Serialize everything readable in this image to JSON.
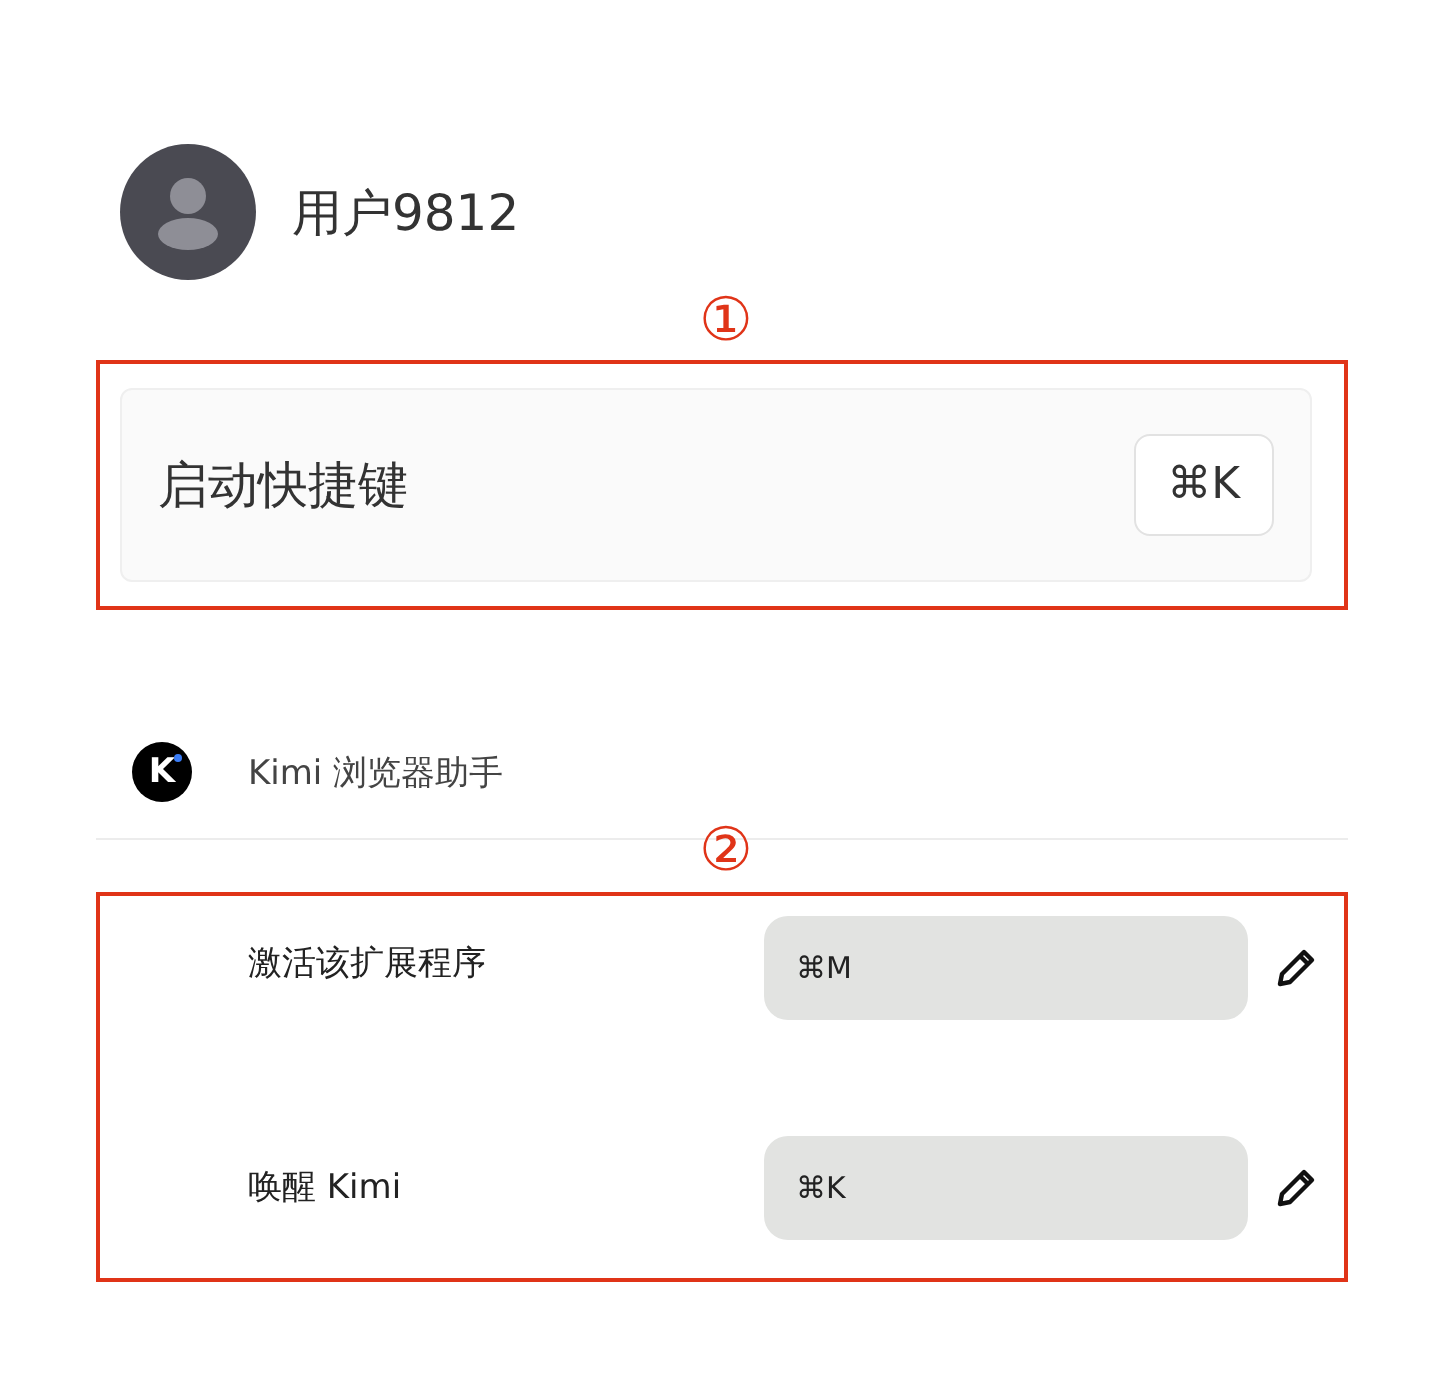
{
  "user": {
    "name": "用户9812"
  },
  "annotations": [
    "①",
    "②"
  ],
  "launch_shortcut": {
    "label": "启动快捷键",
    "key": "⌘K"
  },
  "extension": {
    "logo_text": "K",
    "name": "Kimi 浏览器助手"
  },
  "shortcuts": [
    {
      "label": "激活该扩展程序",
      "value": "⌘M"
    },
    {
      "label": "唤醒 Kimi",
      "value": "⌘K"
    }
  ]
}
